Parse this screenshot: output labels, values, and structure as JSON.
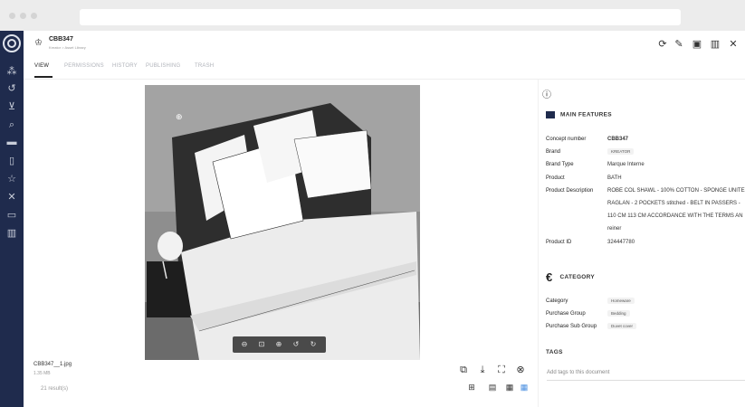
{
  "header": {
    "title": "CBB347",
    "breadcrumb": "Kreator > Asset Library",
    "actions": [
      "sync-icon",
      "edit-icon",
      "panel-icon",
      "trash-icon",
      "share-icon"
    ]
  },
  "tabs": [
    {
      "label": "VIEW",
      "active": true
    },
    {
      "label": "PERMISSIONS",
      "active": false
    },
    {
      "label": "HISTORY",
      "active": false
    },
    {
      "label": "PUBLISHING",
      "active": false
    },
    {
      "label": "TRASH",
      "active": false
    }
  ],
  "sidebar": {
    "icons": [
      "logo-icon",
      "hierarchy-icon",
      "history-icon",
      "cart-icon",
      "search-icon",
      "folder-icon",
      "document-icon",
      "star-icon",
      "share-icon",
      "clipboard-icon",
      "trash-icon"
    ]
  },
  "file": {
    "name": "CBB347__1.jpg",
    "size": "1.35 MB",
    "results": "21 result(s)"
  },
  "viewer_controls": [
    "zoom-out-icon",
    "fit-icon",
    "zoom-in-icon",
    "rotate-left-icon",
    "rotate-right-icon"
  ],
  "panel": {
    "info_icon": "info-icon",
    "main_features_title": "MAIN FEATURES",
    "features": [
      {
        "label": "Concept number",
        "value": "CBB347",
        "bold": true
      },
      {
        "label": "Brand",
        "value": "KREATOR",
        "chip": true
      },
      {
        "label": "Brand Type",
        "value": "Marque Interne"
      },
      {
        "label": "Product",
        "value": "BATH"
      },
      {
        "label": "Product Description",
        "value": "ROBE COL SHAWL - 100% COTTON - SPONGE UNITE"
      },
      {
        "label": "",
        "value": "RAGLAN - 2 POCKETS stitched - BELT IN PASSERS -"
      },
      {
        "label": "",
        "value": "110 CM 113 CM ACCORDANCE WITH THE TERMS AN"
      },
      {
        "label": "",
        "value": "reiner"
      },
      {
        "label": "Product ID",
        "value": "324447780"
      }
    ],
    "category_title": "CATEGORY",
    "categories": [
      {
        "label": "Category",
        "value": "Homeware"
      },
      {
        "label": "Purchase Group",
        "value": "Bedding"
      },
      {
        "label": "Purchase Sub Group",
        "value": "Duvet cover"
      }
    ],
    "tags_title": "TAGS",
    "tags_placeholder": "Add tags to this document"
  },
  "bottom_actions": [
    "open-external-icon",
    "download-icon",
    "expand-icon",
    "close-circle-icon"
  ],
  "view_modes": [
    "tag-view-icon",
    "file-view-icon",
    "grid-view-icon",
    "list-view-icon"
  ]
}
